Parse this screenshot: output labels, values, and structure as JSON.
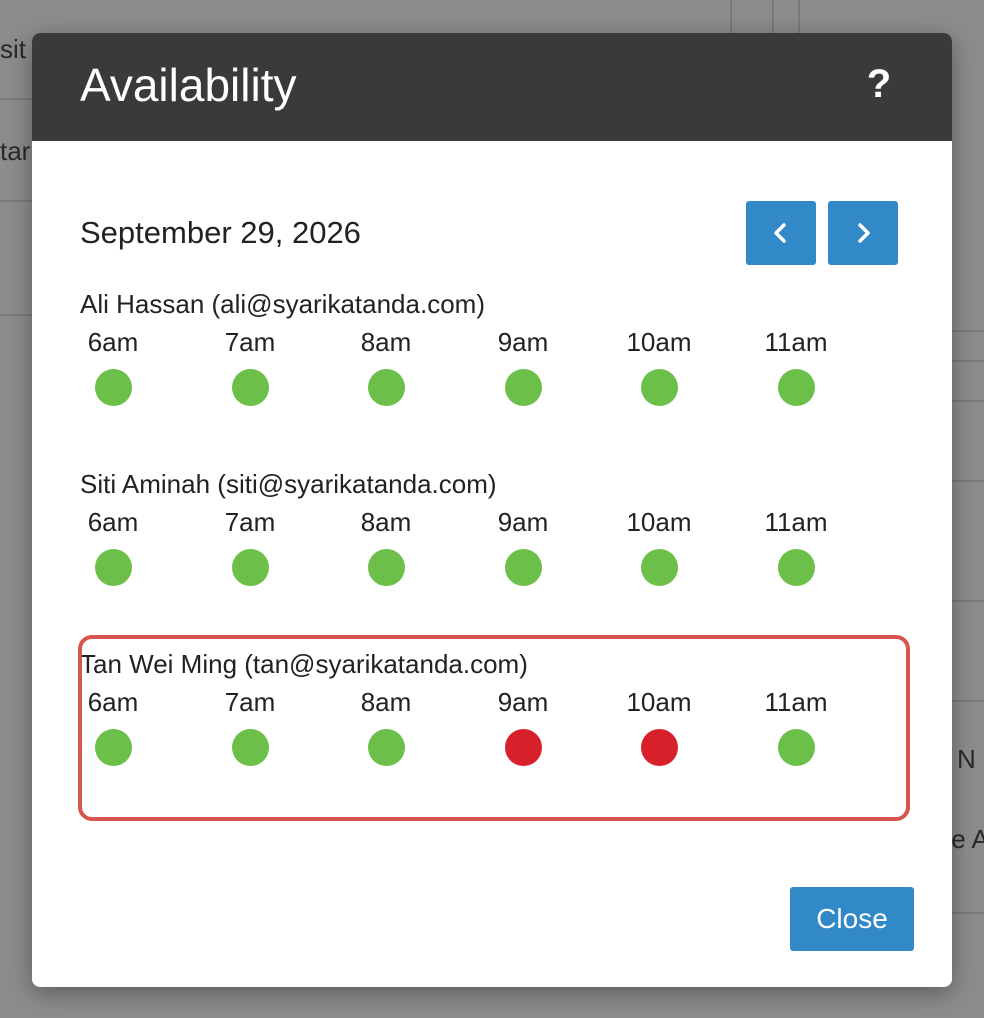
{
  "background": {
    "fragments": [
      "sit",
      "tar",
      "l N",
      "te A"
    ]
  },
  "modal": {
    "title": "Availability",
    "help_symbol": "?",
    "date": "September 29, 2026",
    "close_label": "Close"
  },
  "colors": {
    "available": "#6cc04a",
    "busy": "#d7202a",
    "header": "#3a3a3a",
    "primary_button": "#3289c8",
    "highlight": "#d9534f"
  },
  "people": [
    {
      "name": "Ali Hassan (ali@syarikatanda.com)",
      "slots": [
        {
          "time": "6am",
          "status": "available"
        },
        {
          "time": "7am",
          "status": "available"
        },
        {
          "time": "8am",
          "status": "available"
        },
        {
          "time": "9am",
          "status": "available"
        },
        {
          "time": "10am",
          "status": "available"
        },
        {
          "time": "11am",
          "status": "available"
        }
      ]
    },
    {
      "name": "Siti Aminah (siti@syarikatanda.com)",
      "slots": [
        {
          "time": "6am",
          "status": "available"
        },
        {
          "time": "7am",
          "status": "available"
        },
        {
          "time": "8am",
          "status": "available"
        },
        {
          "time": "9am",
          "status": "available"
        },
        {
          "time": "10am",
          "status": "available"
        },
        {
          "time": "11am",
          "status": "available"
        }
      ]
    },
    {
      "name": "Tan Wei Ming (tan@syarikatanda.com)",
      "highlighted": true,
      "slots": [
        {
          "time": "6am",
          "status": "available"
        },
        {
          "time": "7am",
          "status": "available"
        },
        {
          "time": "8am",
          "status": "available"
        },
        {
          "time": "9am",
          "status": "busy"
        },
        {
          "time": "10am",
          "status": "busy"
        },
        {
          "time": "11am",
          "status": "available"
        }
      ]
    }
  ]
}
